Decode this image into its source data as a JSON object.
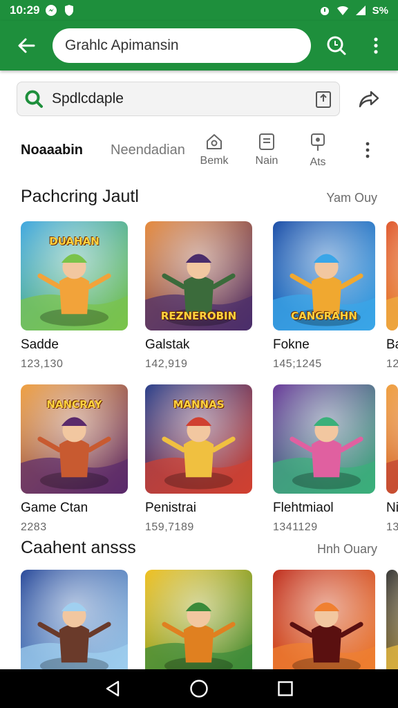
{
  "status": {
    "time": "10:29",
    "battery": "S%"
  },
  "appbar": {
    "search_text": "Grahlc Apimansin"
  },
  "search": {
    "text": "Spdlcdaple"
  },
  "tabs": {
    "tab_active": "Noaaabin",
    "tab_inactive": "Neendadian",
    "icon_tabs": [
      {
        "label": "Bemk",
        "icon": "home-icon"
      },
      {
        "label": "Nain",
        "icon": "document-icon"
      },
      {
        "label": "Ats",
        "icon": "pin-icon"
      }
    ]
  },
  "section1": {
    "title": "Pachcring Jautl",
    "link": "Yam Ouy",
    "cards": [
      {
        "name": "Sadde",
        "count": "123,130",
        "art_text": "DUAHAN",
        "colors": [
          "#3fa7e0",
          "#7ac34a",
          "#f2a33a"
        ]
      },
      {
        "name": "Galstak",
        "count": "142,919",
        "art_text": "REZNEROBIN",
        "colors": [
          "#e68a3c",
          "#4a2d6b",
          "#3b6b3b"
        ]
      },
      {
        "name": "Fokne",
        "count": "145;1245",
        "art_text": "CANGRAHN",
        "colors": [
          "#1d4fa8",
          "#3aa6e8",
          "#f0a830"
        ]
      },
      {
        "name": "Ba",
        "count": "12",
        "art_text": "",
        "colors": [
          "#e05a30",
          "#f0b040",
          "#7a2020"
        ]
      }
    ]
  },
  "section2": {
    "cards": [
      {
        "name": "Game Ctan",
        "count": "2283",
        "art_text": "NANCRAY",
        "colors": [
          "#f0a040",
          "#5a2a6b",
          "#c85a30"
        ]
      },
      {
        "name": "Penistrai",
        "count": "159,7189",
        "art_text": "MANNAS",
        "colors": [
          "#2a3f8a",
          "#d04030",
          "#f0c040"
        ]
      },
      {
        "name": "Flehtmiaol",
        "count": "1341129",
        "art_text": "",
        "colors": [
          "#6a3a9a",
          "#3ab07a",
          "#e060a0"
        ]
      },
      {
        "name": "Ni",
        "count": "13",
        "art_text": "",
        "colors": [
          "#f0a040",
          "#c04030",
          "#fff0c0"
        ]
      }
    ]
  },
  "section3": {
    "title": "Caahent ansss",
    "link": "Hnh Ouary",
    "cards": [
      {
        "colors": [
          "#2a4a9a",
          "#a0d0f0",
          "#6a3a2a"
        ]
      },
      {
        "colors": [
          "#f0c020",
          "#3a8a3a",
          "#e08020"
        ]
      },
      {
        "colors": [
          "#c03020",
          "#f08030",
          "#5a1010"
        ]
      },
      {
        "colors": [
          "#3a3a3a",
          "#f0c040",
          "#222222"
        ]
      }
    ]
  }
}
